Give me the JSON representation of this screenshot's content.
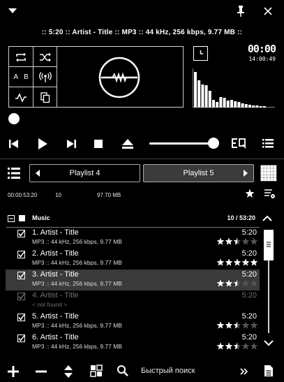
{
  "player": {
    "track_info": ":: 5:20 :: Artist - Title :: MP3 :: 44 kHz, 256 kbps, 9.77 MB ::",
    "time_main": "00:00",
    "time_sub": "14:00:49",
    "ab_a": "A",
    "ab_b": "B",
    "volume_fraction": 0.92,
    "spectrum_levels": [
      0.95,
      0.72,
      0.62,
      0.6,
      0.45,
      0.2,
      0.15,
      0.28,
      0.25,
      0.18,
      0.2,
      0.16,
      0.14,
      0.12,
      0.1,
      0.08,
      0.06,
      0.05,
      0.04,
      0.03
    ]
  },
  "playlist": {
    "tabs": [
      {
        "label": "Playlist 4",
        "active": false
      },
      {
        "label": "Playlist 5",
        "active": true
      }
    ],
    "stats": {
      "time": "00:00:53:20",
      "count": "10",
      "size": "97.70 MB"
    },
    "group": {
      "name": "Music",
      "summary": "10 / 53:20"
    },
    "tracks": [
      {
        "title": "1. Artist - Title",
        "info": "MP3 :: 44 kHz, 256 kbps, 9.77 MB",
        "duration": "5:20",
        "rating": 2.5,
        "selected": false,
        "missing": false
      },
      {
        "title": "2. Artist - Title",
        "info": "MP3 :: 44 kHz, 256 kbps, 9.77 MB",
        "duration": "5:20",
        "rating": 5,
        "selected": false,
        "missing": false
      },
      {
        "title": "3. Artist - Title",
        "info": "MP3 :: 44 kHz, 256 kbps, 9.77 MB",
        "duration": "5:20",
        "rating": 2.5,
        "selected": true,
        "missing": false
      },
      {
        "title": "4. Artist - Title",
        "info": "< not found >",
        "duration": "5:20",
        "rating": 0,
        "selected": false,
        "missing": true
      },
      {
        "title": "5. Artist - Title",
        "info": "MP3 :: 44 kHz, 256 kbps, 9.77 MB",
        "duration": "5:20",
        "rating": 2.5,
        "selected": false,
        "missing": false
      },
      {
        "title": "6. Artist - Title",
        "info": "MP3 :: 44 kHz, 256 kbps, 9.77 MB",
        "duration": "5:20",
        "rating": 2.5,
        "selected": false,
        "missing": false
      }
    ],
    "quick_search": "Быстрый поиск"
  },
  "colors": {
    "background": "#000000",
    "foreground": "#ffffff",
    "selection": "#3a3a3a",
    "dim": "#6e6e6e"
  }
}
